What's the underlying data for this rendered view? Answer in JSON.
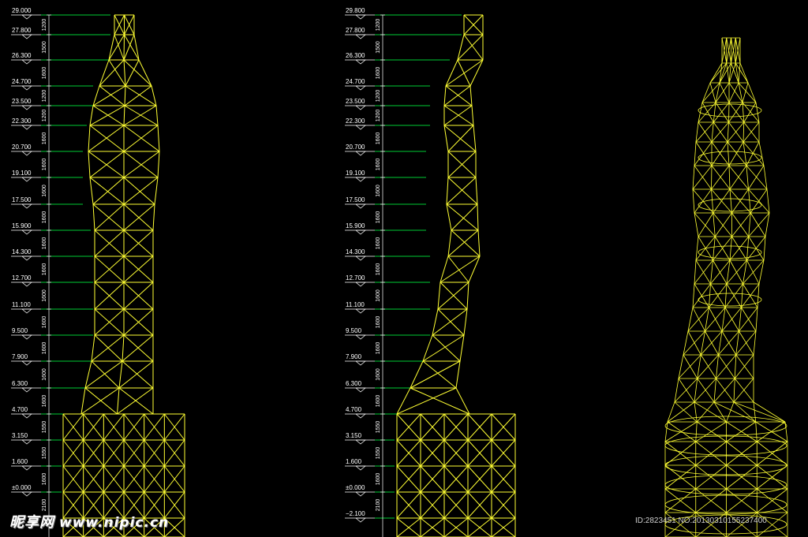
{
  "colors": {
    "background": "#000000",
    "frame": "#ffff33",
    "level_line": "#00cc33",
    "text": "#ffffff"
  },
  "left_levels": [
    "29.000",
    "27.800",
    "26.300",
    "24.700",
    "23.500",
    "22.300",
    "20.700",
    "19.100",
    "17.500",
    "15.900",
    "14.300",
    "12.700",
    "11.100",
    "9.500",
    "7.900",
    "6.300",
    "4.700",
    "3.150",
    "1.600",
    "±0.000"
  ],
  "left_dims": [
    "1200",
    "1500",
    "1600",
    "1200",
    "1200",
    "1600",
    "1600",
    "1600",
    "1600",
    "1600",
    "1600",
    "1600",
    "1600",
    "1600",
    "1600",
    "1600",
    "1550",
    "1550",
    "1600",
    "2100"
  ],
  "right_levels": [
    "29.800",
    "27.800",
    "26.300",
    "24.700",
    "23.500",
    "22.300",
    "20.700",
    "19.100",
    "17.500",
    "15.900",
    "14.300",
    "12.700",
    "11.100",
    "9.500",
    "7.900",
    "6.300",
    "4.700",
    "3.150",
    "1.600",
    "±0.000",
    "−2.100"
  ],
  "right_dims": [
    "1200",
    "1500",
    "1600",
    "1200",
    "1200",
    "1600",
    "1600",
    "1600",
    "1600",
    "1600",
    "1600",
    "1600",
    "1600",
    "1600",
    "1600",
    "1600",
    "1550",
    "1550",
    "1600",
    "2100"
  ],
  "watermark": {
    "brand": "昵享网",
    "url": "www.nipic.cn"
  },
  "image_id": "ID:2823451 NO:20130310155237400"
}
